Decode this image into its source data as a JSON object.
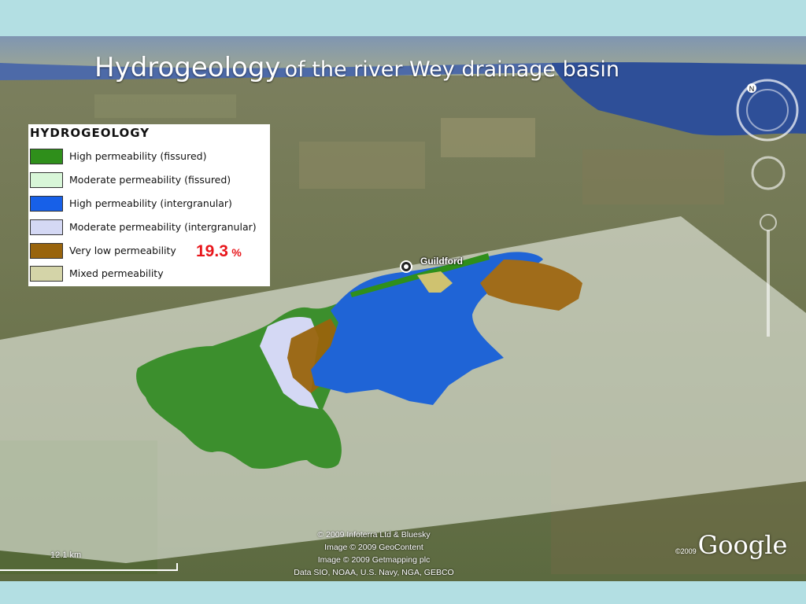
{
  "title": {
    "main": "Hydrogeology",
    "rest": "of the river Wey drainage basin"
  },
  "legend": {
    "heading": "HYDROGEOLOGY",
    "items": [
      {
        "label": "High permeability (fissured)",
        "color": "#2f8f1b"
      },
      {
        "label": "Moderate permeability (fissured)",
        "color": "#d8f6d8"
      },
      {
        "label": "High permeability (intergranular)",
        "color": "#1760e8"
      },
      {
        "label": "Moderate permeability (intergranular)",
        "color": "#d4d8f4"
      },
      {
        "label": "Very low permeability",
        "color": "#99640c"
      },
      {
        "label": "Mixed permeability",
        "color": "#d4d4a8"
      }
    ]
  },
  "annotation": {
    "value": "19.3",
    "unit": "%",
    "color": "#e8161b"
  },
  "place_label": "Guildford",
  "map_attribution": {
    "lines": [
      "© 2009 Infoterra Ltd & Bluesky",
      "Image © 2009 GeoContent",
      "Image © 2009 Getmapping plc",
      "Data SIO, NOAA, U.S. Navy, NGA, GEBCO"
    ],
    "logo_year": "©2009",
    "logo": "Google"
  },
  "scale_bar": {
    "label": "12.1 km"
  },
  "controls": {
    "compass_letter": "N",
    "compass_icon": "compass-icon",
    "zoom_icon": "zoom-slider-icon"
  }
}
